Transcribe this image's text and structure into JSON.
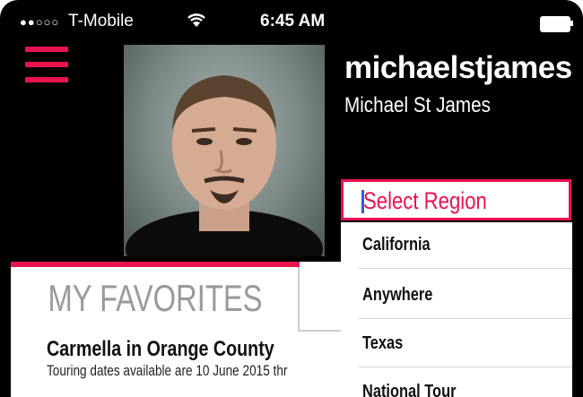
{
  "status_bar": {
    "signal": "●●○○○",
    "carrier": "T-Mobile",
    "wifi": "wifi-icon",
    "time": "6:45 AM",
    "battery": "battery-icon"
  },
  "menu": {
    "icon": "hamburger-menu-icon"
  },
  "profile": {
    "username": "michaelstjames",
    "full_name": "Michael St James"
  },
  "region_dropdown": {
    "placeholder": "Select Region",
    "options": [
      "California",
      "Anywhere",
      "Texas",
      "National Tour"
    ]
  },
  "favorites": {
    "tab_label": "MY FAVORITES",
    "item_title": "Carmella in Orange County",
    "item_description": "Touring dates available are 10 June 2015 thr"
  },
  "colors": {
    "accent": "#e8134f",
    "background": "#000000",
    "caret": "#2f5be0"
  }
}
